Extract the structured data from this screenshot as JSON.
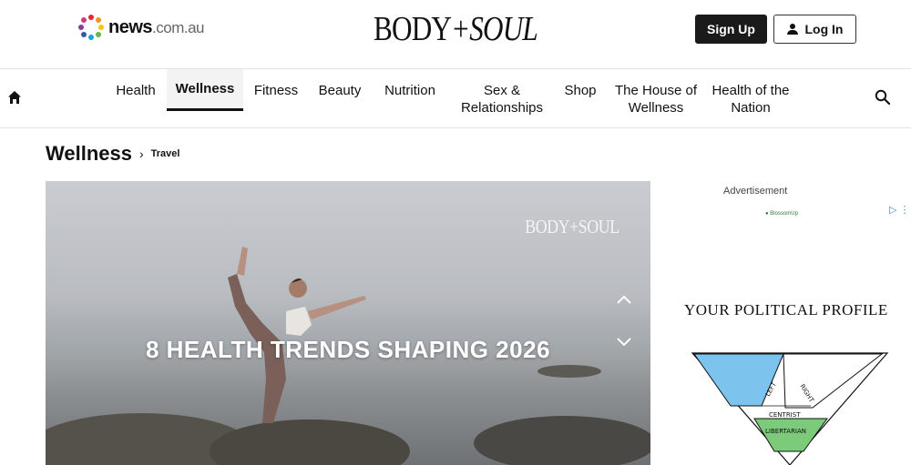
{
  "header": {
    "news_logo": "news",
    "news_logo_domain": ".com.au",
    "brand": "BODY",
    "brand_plus": "+SOUL",
    "signup_label": "Sign Up",
    "login_label": "Log In"
  },
  "nav": {
    "items": [
      {
        "label": "Health"
      },
      {
        "label": "Wellness",
        "active": true
      },
      {
        "label": "Fitness"
      },
      {
        "label": "Beauty"
      },
      {
        "label": "Nutrition"
      },
      {
        "label": "Sex & Relationships"
      },
      {
        "label": "Shop"
      },
      {
        "label": "The House of Wellness"
      },
      {
        "label": "Health of the Nation"
      }
    ],
    "home_icon": "home-icon",
    "search_icon": "search-icon"
  },
  "breadcrumb": {
    "section": "Wellness",
    "separator": "›",
    "subsection": "Travel"
  },
  "hero": {
    "brand": "BODY+SOUL",
    "title": "8 HEALTH TRENDS SHAPING 2026",
    "up_icon": "chevron-up-icon",
    "down_icon": "chevron-down-icon"
  },
  "ad": {
    "label": "Advertisement",
    "choice": "▷ ⋮",
    "brand": "● BlossomUp",
    "title": "YOUR POLITICAL PROFILE",
    "chart_labels": [
      "LEFT",
      "RIGHT",
      "CENTRIST",
      "LIBERTARIAN"
    ]
  },
  "colors": {
    "accent": "#111111",
    "ad_blue": "#7cc4ee",
    "ad_green": "#7ccb7a"
  }
}
